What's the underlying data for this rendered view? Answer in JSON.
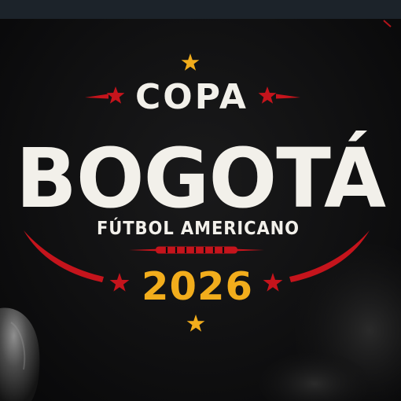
{
  "logo": {
    "eyebrow": "COPA",
    "title": "BOGOTÁ",
    "subtitle": "FÚTBOL AMERICANO",
    "year": "2026"
  },
  "colors": {
    "background": "#0b0b0c",
    "text": "#f2f0ea",
    "accent_red": "#c5141c",
    "accent_gold": "#f2ad1c"
  },
  "icons": [
    "star-icon",
    "football-laces-icon"
  ]
}
